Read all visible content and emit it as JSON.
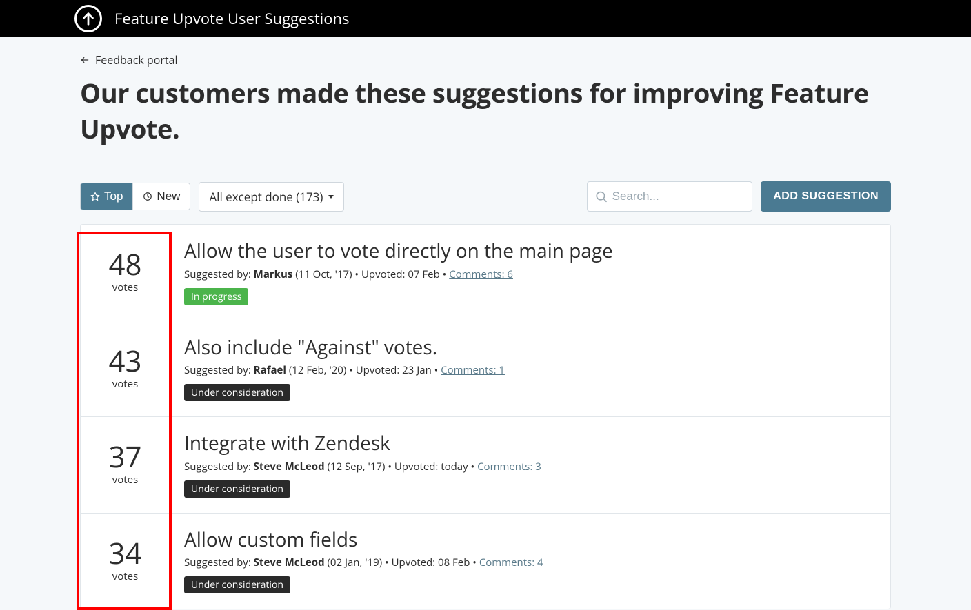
{
  "header": {
    "title": "Feature Upvote User Suggestions"
  },
  "back_link": "Feedback portal",
  "page_title": "Our customers made these suggestions for improving Feature Upvote.",
  "sort": {
    "top": "Top",
    "new": "New"
  },
  "filter": {
    "label": "All except done (173)"
  },
  "search": {
    "placeholder": "Search..."
  },
  "add_button": "ADD SUGGESTION",
  "labels": {
    "votes": "votes",
    "suggested_by": "Suggested by:",
    "upvoted": "Upvoted:",
    "comments": "Comments:"
  },
  "statuses": {
    "in_progress": "In progress",
    "under_consideration": "Under consideration"
  },
  "items": [
    {
      "votes": 48,
      "title": "Allow the user to vote directly on the main page",
      "author": "Markus",
      "date": "(11 Oct, '17)",
      "upvoted": "07 Feb",
      "comments": 6,
      "status_key": "in_progress"
    },
    {
      "votes": 43,
      "title": "Also include \"Against\" votes.",
      "author": "Rafael",
      "date": "(12 Feb, '20)",
      "upvoted": "23 Jan",
      "comments": 1,
      "status_key": "under_consideration"
    },
    {
      "votes": 37,
      "title": "Integrate with Zendesk",
      "author": "Steve McLeod",
      "date": "(12 Sep, '17)",
      "upvoted": "today",
      "comments": 3,
      "status_key": "under_consideration"
    },
    {
      "votes": 34,
      "title": "Allow custom fields",
      "author": "Steve McLeod",
      "date": "(02 Jan, '19)",
      "upvoted": "08 Feb",
      "comments": 4,
      "status_key": "under_consideration"
    }
  ]
}
